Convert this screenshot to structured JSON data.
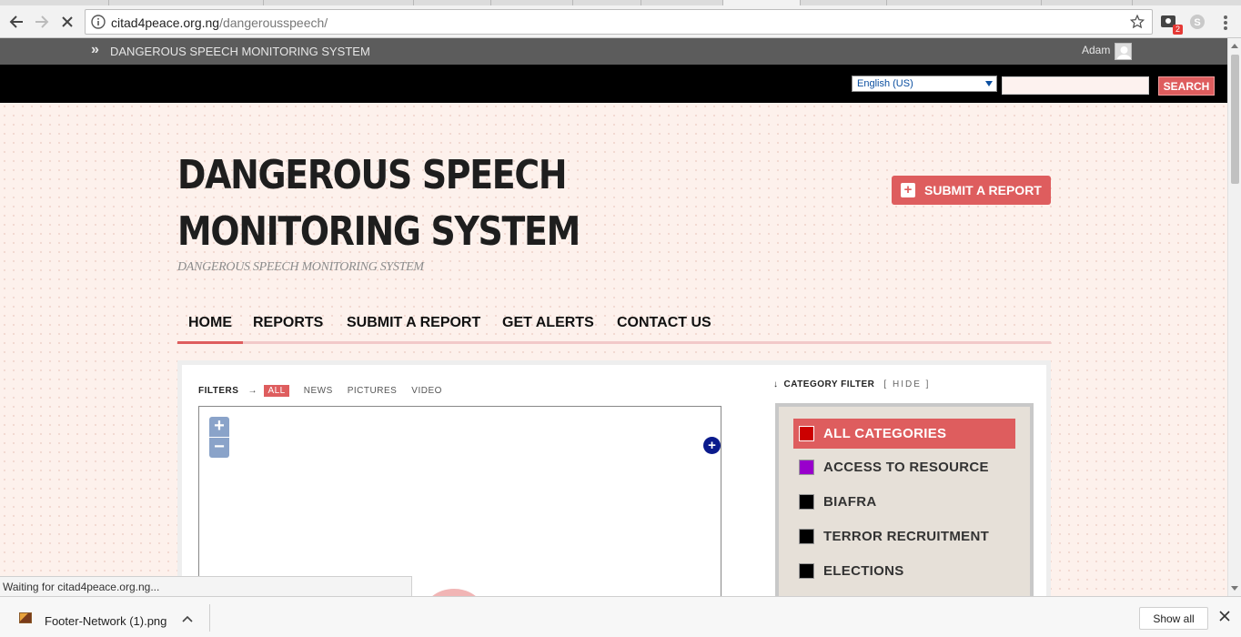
{
  "browser": {
    "url_host": "citad4peace.org.ng",
    "url_path": "/dangerousspeech/",
    "extension_badge": "2",
    "status_text": "Waiting for citad4peace.org.ng...",
    "download": {
      "file_name": "Footer-Network (1).png",
      "show_all_label": "Show all"
    }
  },
  "adminbar": {
    "site_name": "DANGEROUS SPEECH MONITORING SYSTEM",
    "user_name": "Adam"
  },
  "searchbar": {
    "language": "English (US)",
    "search_value": "",
    "search_label": "SEARCH"
  },
  "header": {
    "title": "DANGEROUS SPEECH MONITORING SYSTEM",
    "tagline": "DANGEROUS SPEECH MONITORING SYSTEM",
    "submit_label": "SUBMIT A REPORT"
  },
  "nav": {
    "items": [
      {
        "label": "HOME",
        "active": true
      },
      {
        "label": "REPORTS"
      },
      {
        "label": "SUBMIT A REPORT"
      },
      {
        "label": "GET ALERTS"
      },
      {
        "label": "CONTACT US"
      }
    ]
  },
  "filters": {
    "label": "FILTERS",
    "items": [
      "ALL",
      "NEWS",
      "PICTURES",
      "VIDEO"
    ]
  },
  "map": {
    "zoom_in": "+",
    "zoom_out": "−",
    "layers": "+"
  },
  "category_filter": {
    "label": "CATEGORY FILTER",
    "hide_label": "[ HIDE ]",
    "categories": [
      {
        "label": "ALL CATEGORIES",
        "color": "#cc0000"
      },
      {
        "label": "ACCESS TO RESOURCE",
        "color": "#9900cc"
      },
      {
        "label": "BIAFRA",
        "color": "#000000"
      },
      {
        "label": "TERROR RECRUITMENT",
        "color": "#000000"
      },
      {
        "label": "ELECTIONS",
        "color": "#000000"
      }
    ]
  },
  "colors": {
    "accent": "#de5d5e"
  }
}
